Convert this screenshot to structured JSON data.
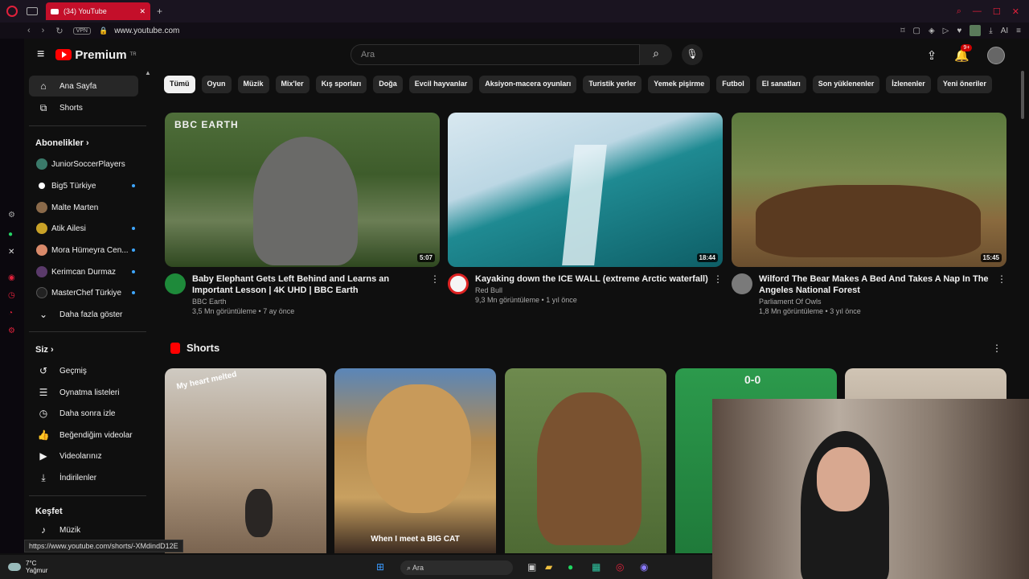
{
  "browser": {
    "tab_title": "(34) YouTube",
    "new_tab": "+",
    "vpn": "VPN",
    "url": "www.youtube.com",
    "ai_label": "AI"
  },
  "header": {
    "logo_text": "Premium",
    "logo_region": "TR",
    "search_placeholder": "Ara",
    "notif_count": "9+"
  },
  "sidebar": {
    "home": "Ana Sayfa",
    "shorts": "Shorts",
    "subs_header": "Abonelikler",
    "channels": [
      {
        "name": "JuniorSoccerPlayers",
        "dot": false,
        "color": "#3a7a6a"
      },
      {
        "name": "Big5 Türkiye",
        "dot": true,
        "color": "#ffffff"
      },
      {
        "name": "Malte Marten",
        "dot": false,
        "color": "#8a6a4a"
      },
      {
        "name": "Atik Ailesi",
        "dot": true,
        "color": "#c9a227"
      },
      {
        "name": "Mora Hümeyra Cen...",
        "dot": true,
        "color": "#d98a6a"
      },
      {
        "name": "Kerimcan Durmaz",
        "dot": true,
        "color": "#5a3a6a"
      },
      {
        "name": "MasterChef Türkiye",
        "dot": true,
        "color": "#222222"
      }
    ],
    "show_more": "Daha fazla göster",
    "you_header": "Siz",
    "you_items": [
      "Geçmiş",
      "Oynatma listeleri",
      "Daha sonra izle",
      "Beğendiğim videolar",
      "Videolarınız",
      "İndirilenler"
    ],
    "explore_header": "Keşfet",
    "explore_items": [
      "Müzik"
    ]
  },
  "chips": [
    "Tümü",
    "Oyun",
    "Müzik",
    "Mix'ler",
    "Kış sporları",
    "Doğa",
    "Evcil hayvanlar",
    "Aksiyon-macera oyunları",
    "Turistik yerler",
    "Yemek pişirme",
    "Futbol",
    "El sanatları",
    "Son yüklenenler",
    "İzlenenler",
    "Yeni öneriler"
  ],
  "videos": [
    {
      "title": "Baby Elephant Gets Left Behind and Learns an Important Lesson | 4K UHD | BBC Earth",
      "channel": "BBC Earth",
      "stats": "3,5 Mn görüntüleme • 7 ay önce",
      "duration": "5:07",
      "thumb_label": "BBC EARTH"
    },
    {
      "title": "Kayaking down the ICE WALL (extreme Arctic waterfall)",
      "channel": "Red Bull",
      "stats": "9,3 Mn görüntüleme • 1 yıl önce",
      "duration": "18:44",
      "thumb_label": ""
    },
    {
      "title": "Wilford The Bear Makes A Bed And Takes A Nap In The Angeles National Forest",
      "channel": "Parliament Of Owls",
      "stats": "1,8 Mn görüntüleme • 3 yıl önce",
      "duration": "15:45",
      "thumb_label": ""
    }
  ],
  "shorts": {
    "header": "Shorts",
    "items": [
      {
        "caption": "My heart melted"
      },
      {
        "caption": "When I meet a BIG CAT"
      },
      {
        "caption": ""
      },
      {
        "caption": "0-0"
      },
      {
        "caption": ""
      }
    ]
  },
  "status_url": "https://www.youtube.com/shorts/-XMdindD12E",
  "taskbar": {
    "temp": "7°C",
    "weather": "Yağmur",
    "search": "Ara"
  },
  "colors": {
    "accent": "#ff0000",
    "opera": "#e0213b",
    "bg": "#0f0f0f"
  }
}
